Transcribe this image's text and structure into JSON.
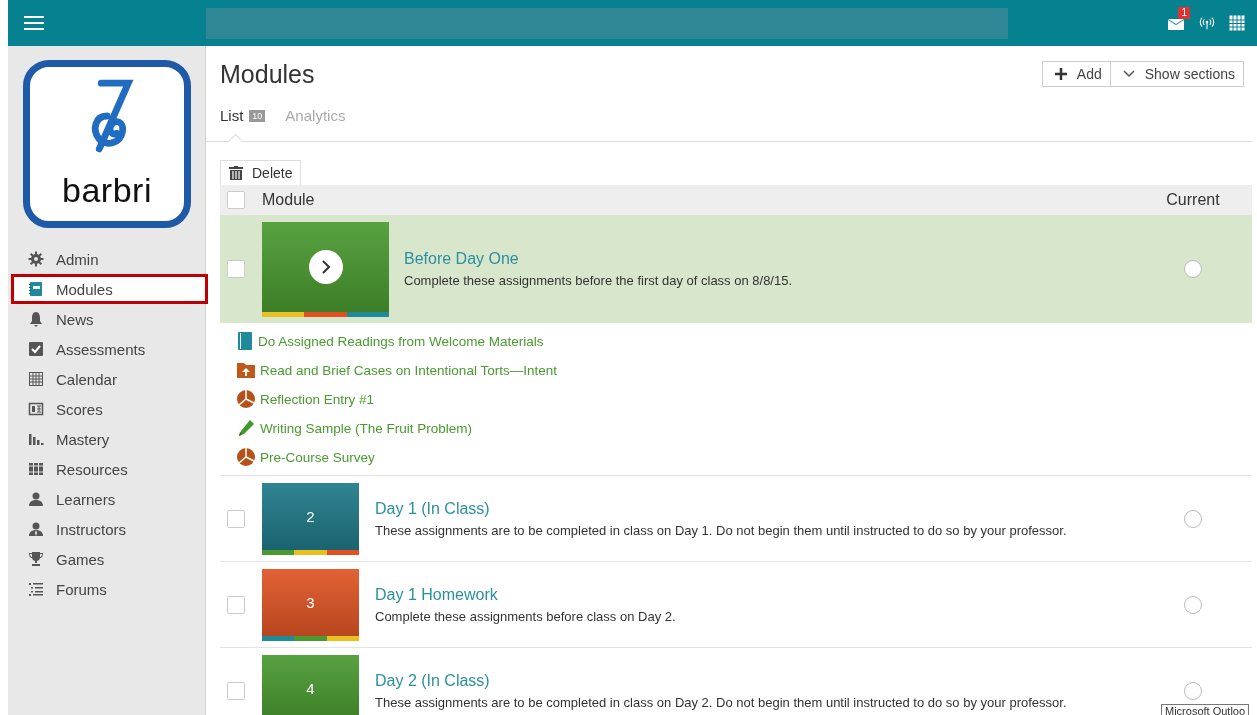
{
  "topbar": {
    "notification_count": "1"
  },
  "logo": {
    "wordmark": "barbri"
  },
  "sidebar": {
    "items": [
      {
        "label": "Admin",
        "selected": false
      },
      {
        "label": "Modules",
        "selected": true
      },
      {
        "label": "News",
        "selected": false
      },
      {
        "label": "Assessments",
        "selected": false
      },
      {
        "label": "Calendar",
        "selected": false
      },
      {
        "label": "Scores",
        "selected": false
      },
      {
        "label": "Mastery",
        "selected": false
      },
      {
        "label": "Resources",
        "selected": false
      },
      {
        "label": "Learners",
        "selected": false
      },
      {
        "label": "Instructors",
        "selected": false
      },
      {
        "label": "Games",
        "selected": false
      },
      {
        "label": "Forums",
        "selected": false
      }
    ]
  },
  "page": {
    "title": "Modules",
    "buttons": [
      {
        "label": "Add",
        "kind": "add"
      },
      {
        "label": "Show sections",
        "kind": "dropdown"
      }
    ],
    "tabs": [
      {
        "label": "List",
        "count": "10",
        "selected": true
      },
      {
        "label": "Analytics",
        "selected": false
      }
    ]
  },
  "table": {
    "delete_button": "Delete",
    "select_all": {
      "checked": false
    },
    "columns": [
      "Module",
      "Current"
    ],
    "rows": [
      {
        "title": "Before Day One",
        "description": "Complete these assignments before the first day of class on 8/8/15.",
        "color": "#4a9a30",
        "stripes": [
          {
            "color": "#e8c020"
          },
          {
            "color": "#e05020"
          },
          {
            "color": "#1f8a9a"
          }
        ],
        "expanded": true,
        "checked": false,
        "current": false,
        "items": [
          {
            "label": "Do Assigned Readings from Welcome Materials",
            "kind": "reading"
          },
          {
            "label": "Read and Brief Cases on Intentional Torts—Intent",
            "kind": "upload"
          },
          {
            "label": "Reflection Entry #1",
            "kind": "survey"
          },
          {
            "label": "Writing Sample (The Fruit Problem)",
            "kind": "writing"
          },
          {
            "label": "Pre-Course Survey",
            "kind": "survey"
          }
        ]
      },
      {
        "title": "Day 1 (In Class)",
        "description": "These assignments are to be completed in class on Day 1. Do not begin them until instructed to do so by your professor.",
        "color": "#1f7a88",
        "number": "2",
        "stripes": [
          {
            "color": "#4a9a30"
          },
          {
            "color": "#e8c020"
          },
          {
            "color": "#e05020"
          }
        ],
        "expanded": false,
        "checked": false,
        "current": false
      },
      {
        "title": "Day 1 Homework",
        "description": "Complete these assignments before class on Day 2.",
        "color": "#e05525",
        "number": "3",
        "stripes": [
          {
            "color": "#1f8a9a"
          },
          {
            "color": "#4a9a30"
          },
          {
            "color": "#e8c020"
          }
        ],
        "expanded": false,
        "checked": false,
        "current": false
      },
      {
        "title": "Day 2 (In Class)",
        "description": "These assignments are to be completed in class on Day 2. Do not begin them until instructed to do so by your professor.",
        "color": "#4a9a30",
        "number": "4",
        "expanded": false,
        "checked": false,
        "current": false
      }
    ]
  },
  "tooltip": {
    "text": "Microsoft Outloo"
  }
}
